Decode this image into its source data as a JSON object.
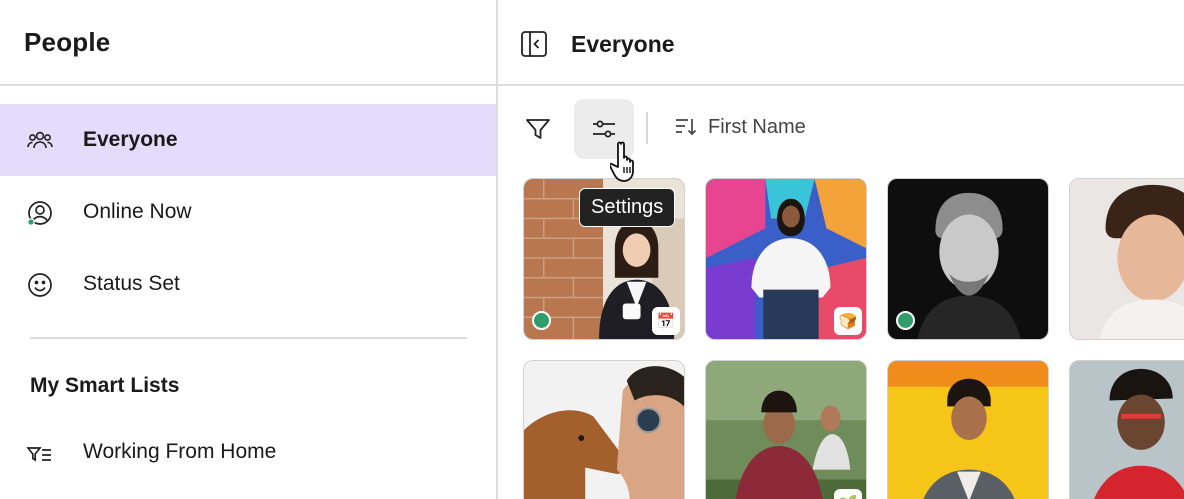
{
  "sidebar": {
    "title": "People",
    "items": [
      {
        "label": "Everyone",
        "icon": "people-icon",
        "active": true
      },
      {
        "label": "Online Now",
        "icon": "user-online-icon"
      },
      {
        "label": "Status Set",
        "icon": "smiley-icon"
      }
    ],
    "section_title": "My Smart Lists",
    "smart_lists": [
      {
        "label": "Working From Home",
        "icon": "smart-filter-icon"
      }
    ]
  },
  "main": {
    "title": "Everyone",
    "toolbar": {
      "sort_label": "First Name",
      "tooltip": "Settings"
    },
    "people": [
      {
        "online": true,
        "badge": "calendar-icon"
      },
      {
        "online": false,
        "badge": "bread-icon"
      },
      {
        "online": true
      },
      {
        "online": false
      },
      {
        "online": false
      },
      {
        "online": false
      },
      {
        "online": false
      },
      {
        "online": false
      }
    ]
  },
  "colors": {
    "active_nav": "#e3dcfb",
    "online": "#2f9e6a",
    "tooltip_bg": "#222222"
  }
}
